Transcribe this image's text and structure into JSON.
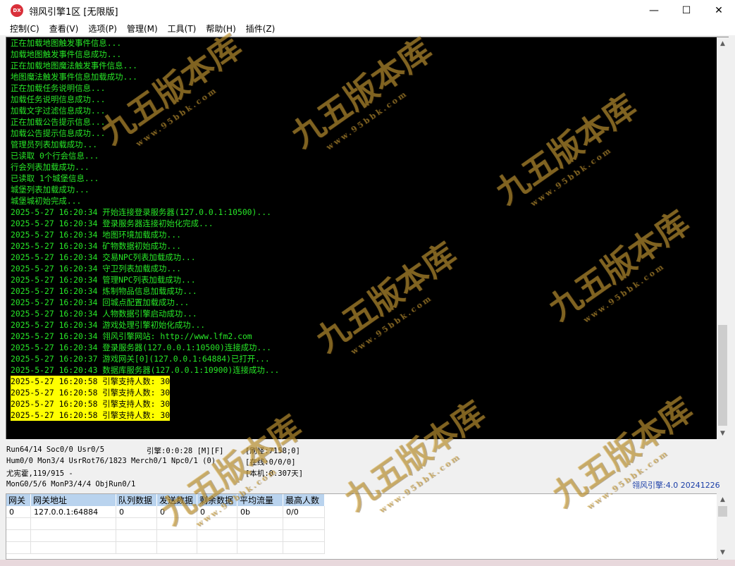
{
  "window": {
    "title": "翎风引擎1区 [无限版]",
    "app_icon_text": "DX",
    "controls": {
      "minimize": "—",
      "maximize": "☐",
      "close": "✕"
    }
  },
  "menu": [
    "控制(C)",
    "查看(V)",
    "选项(P)",
    "管理(M)",
    "工具(T)",
    "帮助(H)",
    "插件(Z)"
  ],
  "console": {
    "lines": [
      "正在加载地图触发事件信息...",
      "加载地图触发事件信息成功...",
      "正在加载地图魔法触发事件信息...",
      "地图魔法触发事件信息加载成功...",
      "正在加载任务说明信息...",
      "加载任务说明信息成功...",
      "加载文字过滤信息成功...",
      "正在加载公告提示信息...",
      "加载公告提示信息成功...",
      "管理员列表加载成功...",
      "已读取 0个行会信息...",
      "行会列表加载成功...",
      "已读取 1个城堡信息...",
      "城堡列表加载成功...",
      "城堡城初始完成...",
      "2025-5-27 16:20:34 开始连接登录服务器(127.0.0.1:10500)...",
      "2025-5-27 16:20:34 登录服务器连接初始化完成...",
      "2025-5-27 16:20:34 地图环境加载成功...",
      "2025-5-27 16:20:34 矿物数据初始成功...",
      "2025-5-27 16:20:34 交易NPC列表加载成功...",
      "2025-5-27 16:20:34 守卫列表加载成功...",
      "2025-5-27 16:20:34 管理NPC列表加载成功...",
      "2025-5-27 16:20:34 炼制物品信息加载成功...",
      "2025-5-27 16:20:34 回城点配置加载成功...",
      "2025-5-27 16:20:34 人物数据引擎启动成功...",
      "2025-5-27 16:20:34 游戏处理引擎初始化成功...",
      "2025-5-27 16:20:34 翎风引擎网站: http://www.lfm2.com",
      "2025-5-27 16:20:34 登录服务器(127.0.0.1:10500)连接成功...",
      "2025-5-27 16:20:37 游戏网关[0](127.0.0.1:64884)已打开...",
      "2025-5-27 16:20:43 数据库服务器(127.0.0.1:10900)连接成功..."
    ],
    "highlighted_lines": [
      "2025-5-27 16:20:58 引擎支持人数: 30",
      "2025-5-27 16:20:58 引擎支持人数: 30",
      "2025-5-27 16:20:58 引擎支持人数: 30",
      "2025-5-27 16:20:58 引擎支持人数: 30"
    ],
    "text_color": "#27e627",
    "highlight_color": "#ffff00"
  },
  "status": {
    "run": "Run64/14 Soc0/0 Usr0/5",
    "engine": "引擎:0:0:28 [M][F]",
    "refresh": "[刷怪:7158;0]",
    "hum": "Hum0/0 Mon3/4 UsrRot76/1823 Merch0/1 Npc0/1 (0)",
    "online": "[在线:0/0/0]",
    "user": "尤宪霍,119/915 -",
    "local": "[本机:0.307天]",
    "mon": "MonG0/5/6 MonP3/4/4 ObjRun0/1",
    "version": "翎风引擎:4.0 20241226"
  },
  "gateway_table": {
    "headers": [
      "网关",
      "网关地址",
      "队列数据",
      "发送数据",
      "剩余数据",
      "平均流量",
      "最高人数"
    ],
    "rows": [
      [
        "0",
        "127.0.0.1:64884",
        "0",
        "0",
        "0",
        "0b",
        "0/0"
      ]
    ]
  },
  "watermark": {
    "text": "九五版本库",
    "url": "www.95bbk.com"
  }
}
